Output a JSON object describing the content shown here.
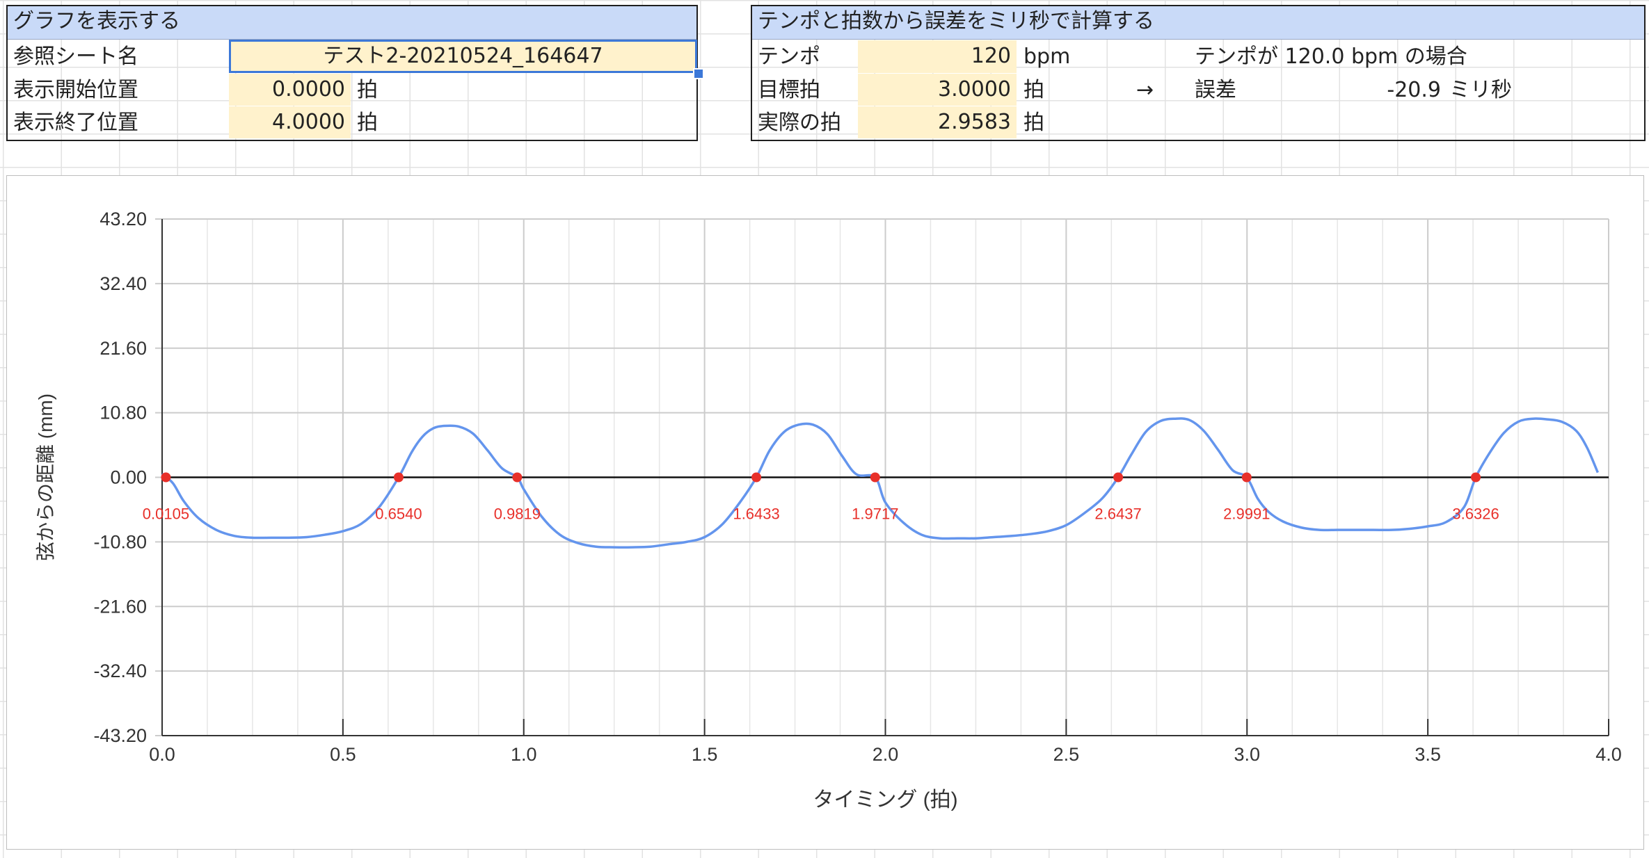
{
  "graph_panel": {
    "title": "グラフを表示する",
    "rows": [
      {
        "label": "参照シート名",
        "value": "テスト2-20210524_164647",
        "unit": ""
      },
      {
        "label": "表示開始位置",
        "value": "0.0000",
        "unit": "拍"
      },
      {
        "label": "表示終了位置",
        "value": "4.0000",
        "unit": "拍"
      }
    ]
  },
  "calc_panel": {
    "title": "テンポと拍数から誤差をミリ秒で計算する",
    "rows": [
      {
        "label": "テンポ",
        "value": "120",
        "unit": "bpm"
      },
      {
        "label": "目標拍",
        "value": "3.0000",
        "unit": "拍"
      },
      {
        "label": "実際の拍",
        "value": "2.9583",
        "unit": "拍"
      }
    ],
    "arrow": "→",
    "result_heading": "テンポが 120.0 bpm の場合",
    "result_label": "誤差",
    "result_value": "-20.9",
    "result_unit": "ミリ秒"
  },
  "colors": {
    "header_bg": "#c9daf8",
    "input_bg": "#fff2cc",
    "selection": "#3c78d8",
    "line": "#6495ed",
    "marker": "#e8302a"
  },
  "chart_data": {
    "type": "line",
    "xlabel": "タイミング (拍)",
    "ylabel": "弦からの距離 (mm)",
    "xlim": [
      0,
      4
    ],
    "ylim": [
      -43.2,
      43.2
    ],
    "x_ticks": [
      "0.0",
      "0.5",
      "1.0",
      "1.5",
      "2.0",
      "2.5",
      "3.0",
      "3.5",
      "4.0"
    ],
    "y_ticks": [
      "43.20",
      "32.40",
      "21.60",
      "10.80",
      "0.00",
      "-10.80",
      "-21.60",
      "-32.40",
      "-43.20"
    ],
    "grid": true,
    "series": [
      {
        "x": [
          0.0,
          0.03,
          0.06,
          0.1,
          0.15,
          0.2,
          0.25,
          0.3,
          0.35,
          0.4,
          0.45,
          0.5,
          0.55,
          0.6,
          0.654,
          0.69,
          0.72,
          0.75,
          0.78,
          0.82,
          0.86,
          0.9,
          0.94,
          0.9819,
          1.0,
          1.05,
          1.1,
          1.15,
          1.2,
          1.25,
          1.3,
          1.35,
          1.4,
          1.45,
          1.5,
          1.55,
          1.6,
          1.6433,
          1.68,
          1.72,
          1.76,
          1.8,
          1.84,
          1.88,
          1.92,
          1.9717,
          2.0,
          2.05,
          2.1,
          2.15,
          2.2,
          2.25,
          2.3,
          2.35,
          2.4,
          2.45,
          2.5,
          2.55,
          2.6,
          2.6437,
          2.68,
          2.72,
          2.76,
          2.8,
          2.84,
          2.88,
          2.92,
          2.96,
          2.9991,
          3.03,
          3.06,
          3.1,
          3.15,
          3.2,
          3.25,
          3.3,
          3.35,
          3.4,
          3.45,
          3.5,
          3.55,
          3.6,
          3.6326,
          3.67,
          3.71,
          3.75,
          3.79,
          3.83,
          3.87,
          3.91,
          3.94,
          3.97
        ],
        "y": [
          0.6,
          -1.0,
          -4.0,
          -6.8,
          -8.8,
          -9.8,
          -10.1,
          -10.1,
          -10.1,
          -10.0,
          -9.6,
          -9.0,
          -7.8,
          -5.0,
          0.0,
          4.2,
          6.8,
          8.2,
          8.6,
          8.5,
          7.3,
          4.5,
          1.5,
          0.0,
          -2.0,
          -6.6,
          -9.6,
          -11.0,
          -11.6,
          -11.7,
          -11.7,
          -11.6,
          -11.2,
          -10.8,
          -10.0,
          -7.8,
          -4.0,
          0.0,
          4.5,
          7.6,
          8.8,
          8.8,
          7.2,
          3.6,
          0.5,
          0.0,
          -4.2,
          -7.6,
          -9.6,
          -10.2,
          -10.2,
          -10.2,
          -10.0,
          -9.8,
          -9.5,
          -9.0,
          -8.0,
          -6.0,
          -3.5,
          0.0,
          3.8,
          7.6,
          9.4,
          9.8,
          9.6,
          7.8,
          4.6,
          1.2,
          0.0,
          -3.6,
          -5.8,
          -7.4,
          -8.4,
          -8.8,
          -8.8,
          -8.8,
          -8.8,
          -8.8,
          -8.6,
          -8.2,
          -7.5,
          -5.0,
          0.0,
          4.0,
          7.4,
          9.3,
          9.8,
          9.7,
          9.3,
          7.8,
          5.0,
          0.8
        ]
      }
    ],
    "zero_crossings": [
      {
        "x": 0.0105,
        "label": "0.0105"
      },
      {
        "x": 0.654,
        "label": "0.6540"
      },
      {
        "x": 0.9819,
        "label": "0.9819"
      },
      {
        "x": 1.6433,
        "label": "1.6433"
      },
      {
        "x": 1.9717,
        "label": "1.9717"
      },
      {
        "x": 2.6437,
        "label": "2.6437"
      },
      {
        "x": 2.9991,
        "label": "2.9991"
      },
      {
        "x": 3.6326,
        "label": "3.6326"
      }
    ]
  }
}
